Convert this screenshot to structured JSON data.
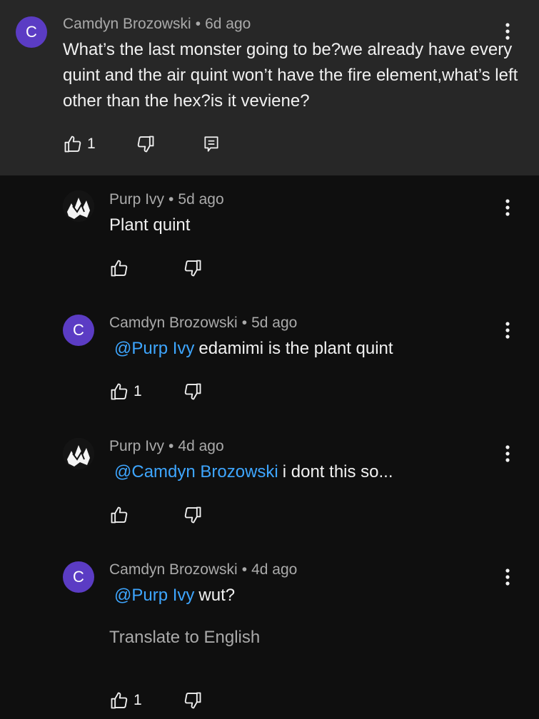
{
  "parent": {
    "avatar_letter": "C",
    "author": "Camdyn Brozowski",
    "separator": "•",
    "time": "6d ago",
    "text": "What’s the last monster going to be?we already have every quint and the air quint won’t have the fire element,what’s left other than the hex?is it veviene?",
    "like_count": "1"
  },
  "replies": [
    {
      "author": "Purp Ivy",
      "separator": "•",
      "time": "5d ago",
      "text": "Plant quint",
      "like_count": ""
    },
    {
      "avatar_letter": "C",
      "author": "Camdyn Brozowski",
      "separator": "•",
      "time": "5d ago",
      "mention": "@Purp Ivy",
      "text": "edamimi is the plant quint",
      "like_count": "1"
    },
    {
      "author": "Purp Ivy",
      "separator": "•",
      "time": "4d ago",
      "mention": "@Camdyn Brozowski",
      "text": "i dont this so...",
      "like_count": ""
    },
    {
      "avatar_letter": "C",
      "author": "Camdyn Brozowski",
      "separator": "•",
      "time": "4d ago",
      "mention": "@Purp Ivy",
      "text": "wut?",
      "translate": "Translate to English",
      "like_count": "1"
    }
  ],
  "colors": {
    "avatar_purple": "#5b3cc4",
    "mention_blue": "#3ea6ff",
    "parent_bg": "#272727",
    "page_bg": "#0f0f0f"
  },
  "icons": [
    "thumb-up-icon",
    "thumb-down-icon",
    "reply-icon",
    "more-vert-icon"
  ]
}
